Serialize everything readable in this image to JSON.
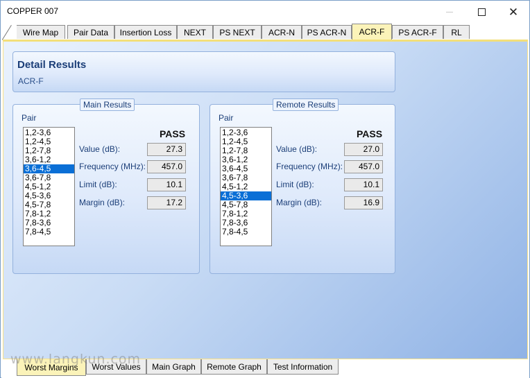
{
  "window": {
    "title": "COPPER 007",
    "minimize_glyph": "—",
    "maximize_glyph": "☐",
    "close_glyph": "✕"
  },
  "top_tabs": [
    "Wire Map",
    "Pair Data",
    "Insertion Loss",
    "NEXT",
    "PS NEXT",
    "ACR-N",
    "PS ACR-N",
    "ACR-F",
    "PS ACR-F",
    "RL"
  ],
  "active_top_tab": "ACR-F",
  "detail": {
    "title": "Detail Results",
    "subtitle": "ACR-F"
  },
  "main_results": {
    "legend": "Main Results",
    "pair_label": "Pair",
    "pairs": [
      "1,2-3,6",
      "1,2-4,5",
      "1,2-7,8",
      "3,6-1,2",
      "3,6-4,5",
      "3,6-7,8",
      "4,5-1,2",
      "4,5-3,6",
      "4,5-7,8",
      "7,8-1,2",
      "7,8-3,6",
      "7,8-4,5"
    ],
    "selected_pair": "3,6-4,5",
    "status": "PASS",
    "value_label": "Value (dB):",
    "value": "27.3",
    "frequency_label": "Frequency (MHz):",
    "frequency": "457.0",
    "limit_label": "Limit (dB):",
    "limit": "10.1",
    "margin_label": "Margin (dB):",
    "margin": "17.2"
  },
  "remote_results": {
    "legend": "Remote Results",
    "pair_label": "Pair",
    "pairs": [
      "1,2-3,6",
      "1,2-4,5",
      "1,2-7,8",
      "3,6-1,2",
      "3,6-4,5",
      "3,6-7,8",
      "4,5-1,2",
      "4,5-3,6",
      "4,5-7,8",
      "7,8-1,2",
      "7,8-3,6",
      "7,8-4,5"
    ],
    "selected_pair": "4,5-3,6",
    "status": "PASS",
    "value_label": "Value (dB):",
    "value": "27.0",
    "frequency_label": "Frequency (MHz):",
    "frequency": "457.0",
    "limit_label": "Limit (dB):",
    "limit": "10.1",
    "margin_label": "Margin (dB):",
    "margin": "16.9"
  },
  "bottom_tabs": [
    "Worst Margins",
    "Worst Values",
    "Main Graph",
    "Remote Graph",
    "Test Information"
  ],
  "active_bottom_tab": "Worst Margins",
  "watermark": "www.langkun.com",
  "colors": {
    "active_tab": "#fbf3b9",
    "selection": "#0a6fd6",
    "heading": "#1b3e78"
  }
}
